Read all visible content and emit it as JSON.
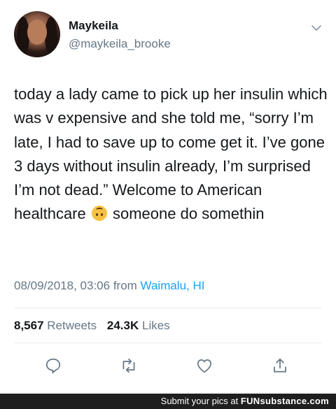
{
  "tweet": {
    "author_name": "Maykeila",
    "author_handle": "@maykeila_brooke",
    "text_before_emoji": "today a lady came to pick up her insulin which was v expensive and she told me, “sorry I’m late, I had to save up to come get it. I’ve gone 3 days without insulin already, I’m surprised I’m not dead.” Welcome to American healthcare",
    "text_after_emoji": "someone do somethin",
    "emoji_icon": "upside-down-face-icon",
    "timestamp": "08/09/2018, 03:06",
    "from_label": "from",
    "location": "Waimalu, HI",
    "retweets_count": "8,567",
    "retweets_label": "Retweets",
    "likes_count": "24.3K",
    "likes_label": "Likes"
  },
  "footer": {
    "submit_text": "Submit your pics at",
    "brand": "FUNsubstance.com"
  },
  "colors": {
    "text": "#14171a",
    "muted": "#657786",
    "link": "#1da1f2",
    "divider": "#e6ecf0",
    "footer_bg": "#1f1f1f"
  }
}
